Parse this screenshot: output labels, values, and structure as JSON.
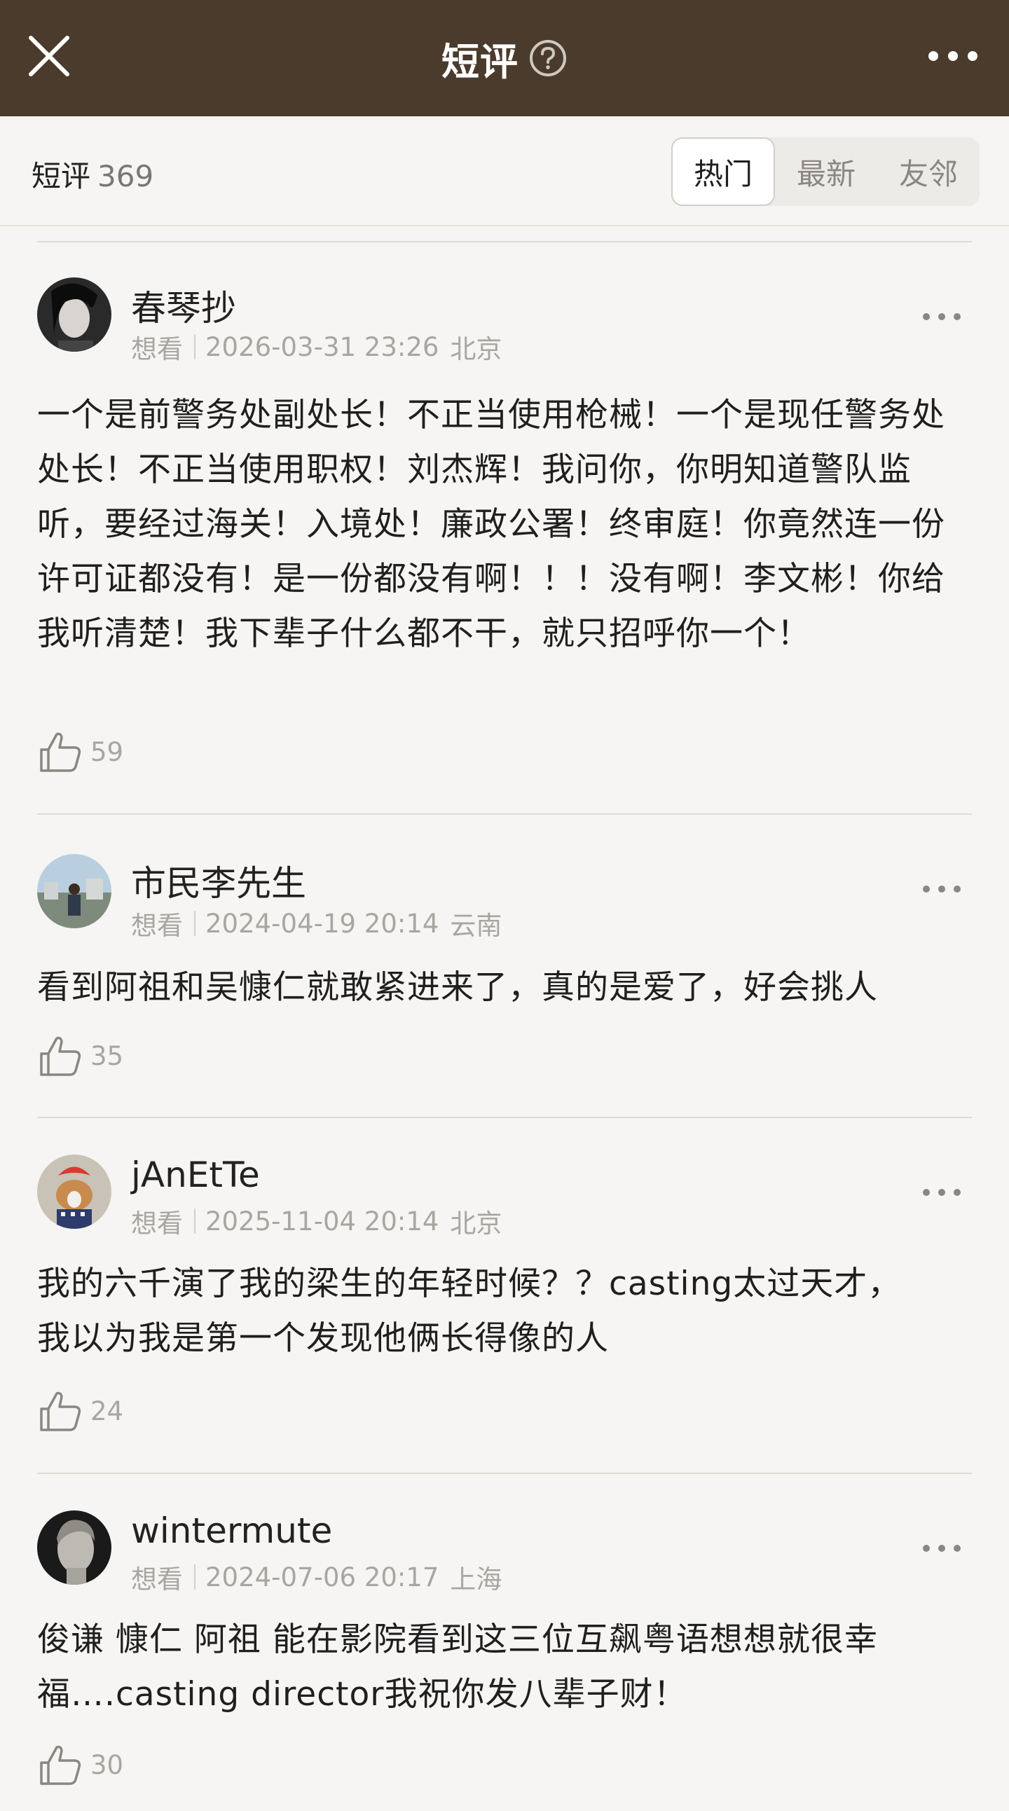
{
  "header": {
    "title": "短评",
    "close_icon": "close-icon",
    "help_icon": "question-circle-icon",
    "more_icon": "more-horizontal-icon",
    "bg_color": "#4a3b2c"
  },
  "subheader": {
    "label": "短评",
    "count": "369",
    "tabs": [
      {
        "label": "热门",
        "selected": true
      },
      {
        "label": "最新",
        "selected": false
      },
      {
        "label": "友邻",
        "selected": false
      }
    ]
  },
  "comments": [
    {
      "username": "春琴抄",
      "status": "想看",
      "datetime": "2026-03-31 23:26",
      "location": "北京",
      "text": "一个是前警务处副处长！不正当使用枪械！一个是现任警务处处长！不正当使用职权！刘杰辉！我问你，你明知道警队监听，要经过海关！入境处！廉政公署！终审庭！你竟然连一份许可证都没有！是一份都没有啊！！！没有啊！李文彬！你给我听清楚！我下辈子什么都不干，就只招呼你一个！",
      "likes": "59"
    },
    {
      "username": "市民李先生",
      "status": "想看",
      "datetime": "2024-04-19 20:14",
      "location": "云南",
      "text": "看到阿祖和吴慷仁就敢紧进来了，真的是爱了，好会挑人",
      "likes": "35"
    },
    {
      "username": "jAnEtTe",
      "status": "想看",
      "datetime": "2025-11-04 20:14",
      "location": "北京",
      "text": "我的六千演了我的梁生的年轻时候？？casting太过天才，我以为我是第一个发现他俩长得像的人",
      "likes": "24"
    },
    {
      "username": "wintermute",
      "status": "想看",
      "datetime": "2024-07-06 20:17",
      "location": "上海",
      "text": "俊谦 慷仁 阿祖 能在影院看到这三位互飙粤语想想就很幸福….casting director我祝你发八辈子财！",
      "likes": "30"
    }
  ]
}
